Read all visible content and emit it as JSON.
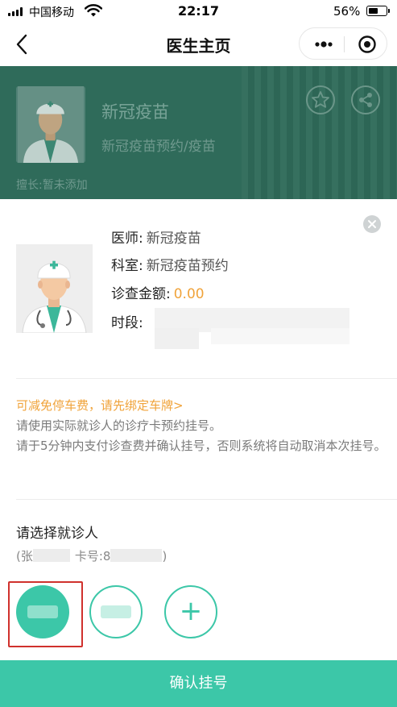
{
  "status_bar": {
    "carrier": "中国移动",
    "time": "22:17",
    "battery_percent": "56%",
    "battery_level": 0.56
  },
  "nav": {
    "title": "医生主页",
    "back_icon": "chevron-left-icon",
    "more_icon": "more-dots-icon",
    "target_icon": "target-circle-icon"
  },
  "header": {
    "doctor_name": "新冠疫苗",
    "department": "新冠疫苗预约/疫苗",
    "specialty": "擅长:暂未添加",
    "icons": [
      "star-icon",
      "share-icon"
    ]
  },
  "sheet": {
    "doctor_label": "医师:",
    "doctor_value": "新冠疫苗",
    "dept_label": "科室:",
    "dept_value": "新冠疫苗预约",
    "fee_label": "诊查金额:",
    "fee_value": "0.00",
    "time_label": "时段:",
    "parking_link": "可减免停车费，请先绑定车牌>",
    "notice_lines": [
      "请使用实际就诊人的诊疗卡预约挂号。",
      "请于5分钟内支付诊查费并确认挂号，否则系统将自动取消本次挂号。"
    ],
    "patient_title": "请选择就诊人",
    "patient_info_prefix": "(张",
    "patient_info_card": "卡号:8",
    "patient_info_suffix": ")",
    "add_patient_symbol": "+",
    "confirm_label": "确认挂号"
  },
  "colors": {
    "accent": "#3cc7a8",
    "header_bg": "#2f6b5a",
    "fee": "#f0a33a",
    "selection_border": "#d0312d"
  }
}
